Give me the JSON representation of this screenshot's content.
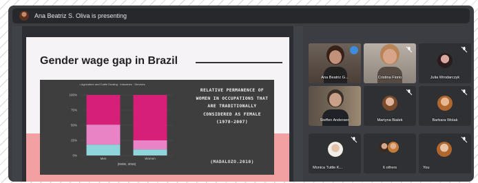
{
  "top_bar": {
    "presenting_text": "Ana Beatriz S. Oliva is presenting"
  },
  "slide": {
    "title": "Gender wage gap in Brazil",
    "note": "Relative permanence of women in occupations that are traditionally considered as female (1978-2007)",
    "source": "(MADALOZO.2010)",
    "legend": "• Agriculture and Cattle Dealing · Industries · Services"
  },
  "chart_data": {
    "type": "bar",
    "stacked": true,
    "categories": [
      "Men",
      "Women"
    ],
    "yticks": [
      "0%",
      "25%",
      "50%",
      "75%",
      "100%"
    ],
    "ylim": [
      0,
      100
    ],
    "xlabel": "(INGE, 2015)",
    "series": [
      {
        "name": "",
        "color": "#8fd6dc",
        "values": [
          18,
          10
        ]
      },
      {
        "name": "",
        "color": "#ea82c6",
        "values": [
          33,
          15
        ]
      },
      {
        "name": "",
        "color": "#d61f77",
        "values": [
          49,
          75
        ]
      }
    ]
  },
  "participants": [
    {
      "name": "Ana Beatriz G...",
      "active": true
    },
    {
      "name": "Cristina Fiorio"
    },
    {
      "name": "Julia Wrodarczyk"
    },
    {
      "name": "Steffen Andersen"
    },
    {
      "name": "Martyna Bialek"
    },
    {
      "name": "Barbara Wolak"
    },
    {
      "name": "Monica Tuttle K..."
    },
    {
      "name": "6 others"
    },
    {
      "name": "You"
    }
  ],
  "colors": {
    "accent": "#5aa9ee",
    "background": "#3b3d42",
    "slide_pink": "#f1a1a1"
  },
  "icons": [
    "mic-muted-icon",
    "mic-active-icon"
  ]
}
